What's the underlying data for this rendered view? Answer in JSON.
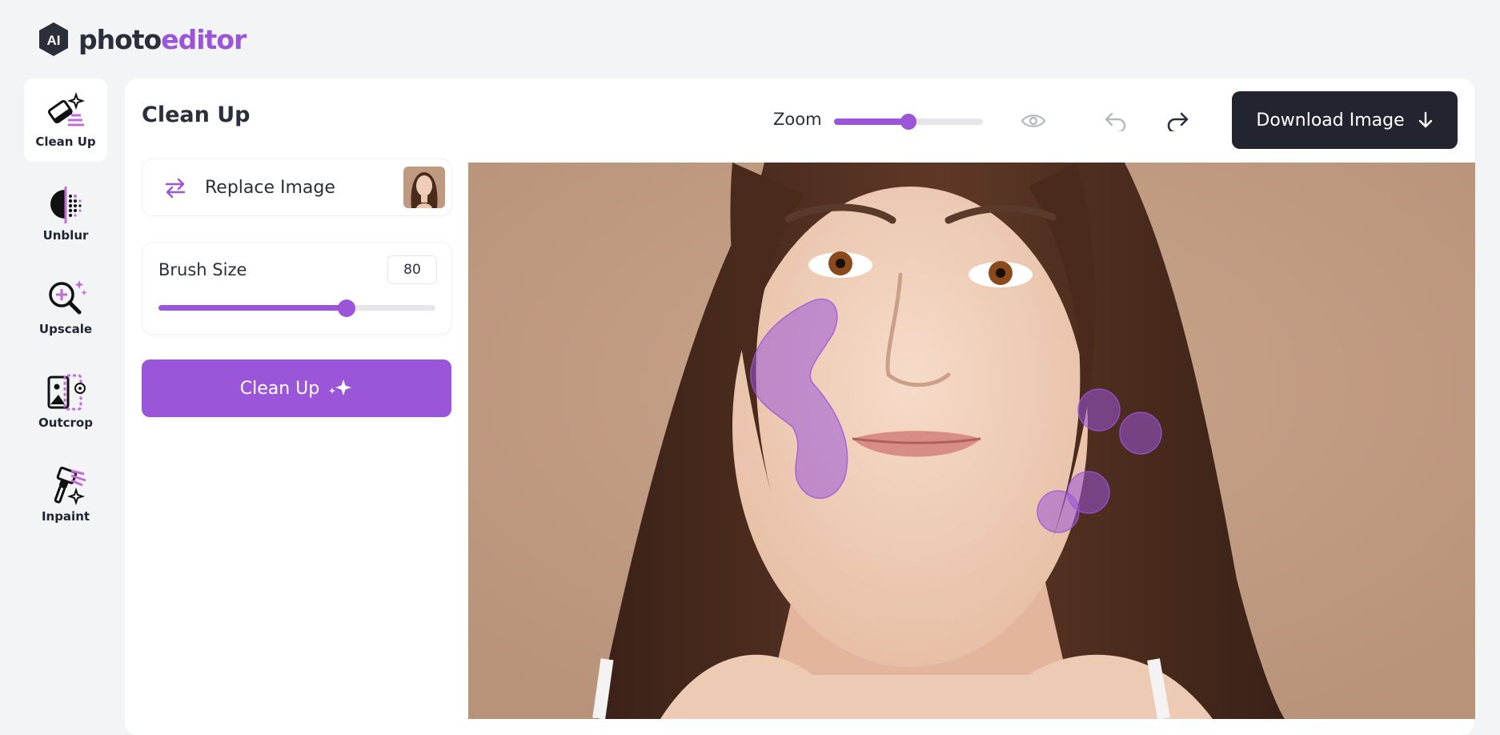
{
  "brand": {
    "part1": "photo",
    "part2": "editor",
    "badge": "AI"
  },
  "tools": [
    {
      "label": "Clean Up",
      "icon": "eraser-sparkle-icon",
      "active": true
    },
    {
      "label": "Unblur",
      "icon": "unblur-icon",
      "active": false
    },
    {
      "label": "Upscale",
      "icon": "upscale-magnifier-icon",
      "active": false
    },
    {
      "label": "Outcrop",
      "icon": "outcrop-icon",
      "active": false
    },
    {
      "label": "Inpaint",
      "icon": "inpaint-brush-icon",
      "active": false
    }
  ],
  "header": {
    "title": "Clean Up",
    "zoom_label": "Zoom",
    "zoom_level": 0.5,
    "download_label": "Download Image"
  },
  "sidebar": {
    "replace_label": "Replace Image",
    "brush_label": "Brush Size",
    "brush_value": "80",
    "brush_fraction": 0.68,
    "cleanup_label": "Clean Up"
  },
  "colors": {
    "accent": "#9b55d8",
    "dark": "#22252f",
    "background": "#f2f4f6"
  }
}
